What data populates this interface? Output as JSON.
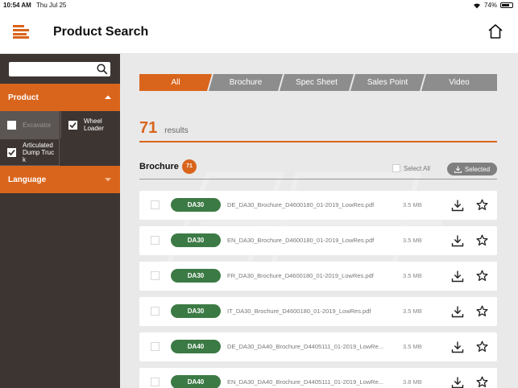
{
  "status_bar": {
    "time": "10:54 AM",
    "date": "Thu Jul 25",
    "battery": "74%",
    "battery_level": 0.74
  },
  "header": {
    "title": "Product Search",
    "menu_icon": "hamburger-menu-icon",
    "home_icon": "home-icon"
  },
  "sidebar": {
    "search": {
      "value": "",
      "placeholder": ""
    },
    "product_header": "Product",
    "filters": [
      {
        "label": "Excavator",
        "checked": false,
        "disabled": true
      },
      {
        "label": "Wheel Loader",
        "checked": true
      },
      {
        "label": "Articulated Dump Truck",
        "checked": true
      }
    ],
    "language_header": "Language"
  },
  "main": {
    "tabs": [
      {
        "label": "All",
        "active": true
      },
      {
        "label": "Brochure"
      },
      {
        "label": "Spec Sheet"
      },
      {
        "label": "Sales Point"
      },
      {
        "label": "Video"
      }
    ],
    "results_count": "71",
    "results_word": "results",
    "section": {
      "title": "Brochure",
      "badge": "71",
      "select_all": "Select All",
      "selected_btn": "Selected"
    },
    "files": [
      {
        "model": "DA30",
        "name": "DE_DA30_Brochure_D4600180_01-2019_LowRes.pdf",
        "size": "3.5 MB"
      },
      {
        "model": "DA30",
        "name": "EN_DA30_Brochure_D4600180_01-2019_LowRes.pdf",
        "size": "3.5 MB"
      },
      {
        "model": "DA30",
        "name": "FR_DA30_Brochure_D4600180_01-2019_LowRes.pdf",
        "size": "3.5 MB"
      },
      {
        "model": "DA30",
        "name": "IT_DA30_Brochure_D4600180_01-2019_LowRes.pdf",
        "size": "3.5 MB"
      },
      {
        "model": "DA40",
        "name": "DE_DA30_DA40_Brochure_D4405111_01-2019_LowRe...",
        "size": "3.5 MB"
      },
      {
        "model": "DA40",
        "name": "EN_DA30_DA40_Brochure_D4405111_01-2019_LowRe...",
        "size": "3.8 MB"
      }
    ]
  },
  "colors": {
    "accent": "#d9651c",
    "sidebar_bg": "#3d3532",
    "model_badge": "#3c7a45",
    "tab_inactive": "#8d8d8d"
  }
}
